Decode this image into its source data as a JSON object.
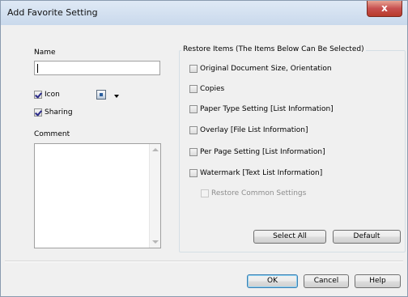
{
  "window": {
    "title": "Add Favorite Setting",
    "close_glyph": "x"
  },
  "left": {
    "name_label": "Name",
    "name_value": "",
    "icon_label": "Icon",
    "icon_checked": true,
    "sharing_label": "Sharing",
    "sharing_checked": true,
    "comment_label": "Comment",
    "comment_value": ""
  },
  "restore": {
    "title": "Restore Items (The Items Below Can Be Selected)",
    "items": [
      {
        "label": "Original Document Size, Orientation",
        "checked": false
      },
      {
        "label": "Copies",
        "checked": false
      },
      {
        "label": "Paper Type Setting [List Information]",
        "checked": false
      },
      {
        "label": "Overlay [File List Information]",
        "checked": false
      },
      {
        "label": "Per Page Setting [List Information]",
        "checked": false
      },
      {
        "label": "Watermark [Text List Information]",
        "checked": false
      }
    ],
    "common": {
      "label": "Restore Common Settings",
      "checked": false,
      "disabled": true
    },
    "select_all_label": "Select All",
    "default_label": "Default"
  },
  "footer": {
    "ok_label": "OK",
    "cancel_label": "Cancel",
    "help_label": "Help"
  },
  "icons": {
    "icon_preview": "printer-settings-icon",
    "dropdown": "chevron-down-icon"
  }
}
